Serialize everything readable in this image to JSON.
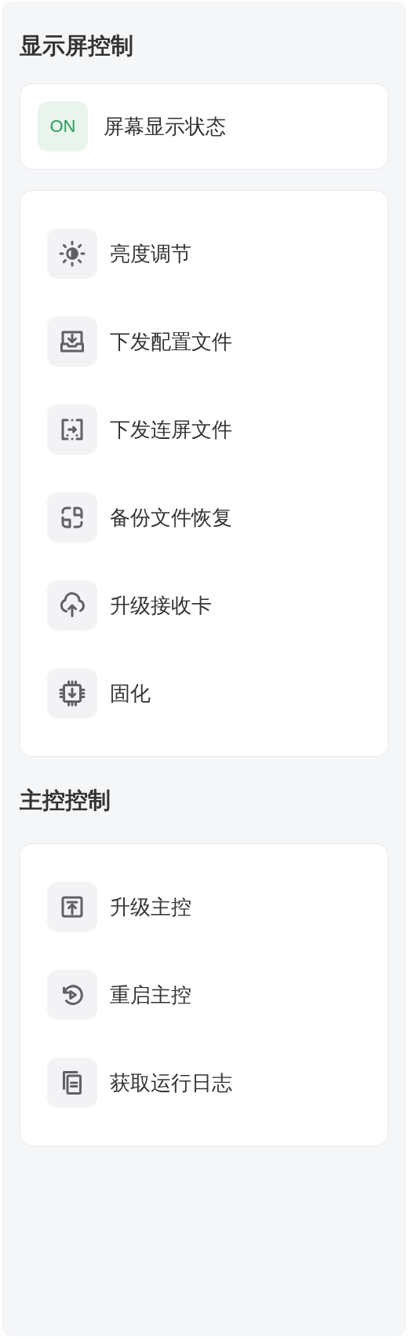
{
  "sections": [
    {
      "title": "显示屏控制",
      "status": {
        "badge": "ON",
        "on": true,
        "label": "屏幕显示状态"
      },
      "items": [
        {
          "label": "亮度调节"
        },
        {
          "label": "下发配置文件"
        },
        {
          "label": "下发连屏文件"
        },
        {
          "label": "备份文件恢复"
        },
        {
          "label": "升级接收卡"
        },
        {
          "label": "固化"
        }
      ]
    },
    {
      "title": "主控控制",
      "items": [
        {
          "label": "升级主控"
        },
        {
          "label": "重启主控"
        },
        {
          "label": "获取运行日志"
        }
      ]
    }
  ]
}
